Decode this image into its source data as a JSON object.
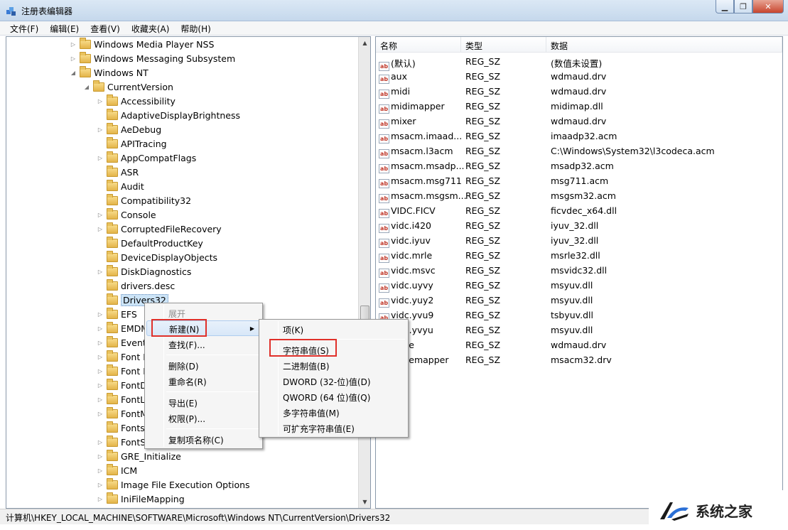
{
  "window": {
    "title": "注册表编辑器"
  },
  "menubar": [
    "文件(F)",
    "编辑(E)",
    "查看(V)",
    "收藏夹(A)",
    "帮助(H)"
  ],
  "tree": {
    "rows": [
      {
        "label": "Windows Media Player NSS",
        "indent": 1,
        "exp": "▷"
      },
      {
        "label": "Windows Messaging Subsystem",
        "indent": 1,
        "exp": "▷"
      },
      {
        "label": "Windows NT",
        "indent": 1,
        "exp": "◢"
      },
      {
        "label": "CurrentVersion",
        "indent": 2,
        "exp": "◢"
      },
      {
        "label": "Accessibility",
        "indent": 3,
        "exp": "▷"
      },
      {
        "label": "AdaptiveDisplayBrightness",
        "indent": 3,
        "exp": ""
      },
      {
        "label": "AeDebug",
        "indent": 3,
        "exp": "▷"
      },
      {
        "label": "APITracing",
        "indent": 3,
        "exp": ""
      },
      {
        "label": "AppCompatFlags",
        "indent": 3,
        "exp": "▷"
      },
      {
        "label": "ASR",
        "indent": 3,
        "exp": ""
      },
      {
        "label": "Audit",
        "indent": 3,
        "exp": ""
      },
      {
        "label": "Compatibility32",
        "indent": 3,
        "exp": ""
      },
      {
        "label": "Console",
        "indent": 3,
        "exp": "▷"
      },
      {
        "label": "CorruptedFileRecovery",
        "indent": 3,
        "exp": "▷"
      },
      {
        "label": "DefaultProductKey",
        "indent": 3,
        "exp": ""
      },
      {
        "label": "DeviceDisplayObjects",
        "indent": 3,
        "exp": ""
      },
      {
        "label": "DiskDiagnostics",
        "indent": 3,
        "exp": "▷"
      },
      {
        "label": "drivers.desc",
        "indent": 3,
        "exp": ""
      },
      {
        "label": "Drivers32",
        "indent": 3,
        "exp": "",
        "selected": true
      },
      {
        "label": "EFS",
        "indent": 3,
        "exp": "▷"
      },
      {
        "label": "EMDM",
        "indent": 3,
        "exp": "▷"
      },
      {
        "label": "Event V",
        "indent": 3,
        "exp": "▷"
      },
      {
        "label": "Font D",
        "indent": 3,
        "exp": "▷"
      },
      {
        "label": "Font M",
        "indent": 3,
        "exp": "▷"
      },
      {
        "label": "FontDi",
        "indent": 3,
        "exp": "▷"
      },
      {
        "label": "FontLin",
        "indent": 3,
        "exp": "▷"
      },
      {
        "label": "FontMa",
        "indent": 3,
        "exp": "▷"
      },
      {
        "label": "Fonts",
        "indent": 3,
        "exp": ""
      },
      {
        "label": "FontSu",
        "indent": 3,
        "exp": "▷"
      },
      {
        "label": "GRE_Initialize",
        "indent": 3,
        "exp": "▷"
      },
      {
        "label": "ICM",
        "indent": 3,
        "exp": "▷"
      },
      {
        "label": "Image File Execution Options",
        "indent": 3,
        "exp": "▷"
      },
      {
        "label": "IniFileMapping",
        "indent": 3,
        "exp": "▷"
      }
    ]
  },
  "values": {
    "headers": [
      "名称",
      "类型",
      "数据"
    ],
    "rows": [
      {
        "name": "(默认)",
        "type": "REG_SZ",
        "data": "(数值未设置)"
      },
      {
        "name": "aux",
        "type": "REG_SZ",
        "data": "wdmaud.drv"
      },
      {
        "name": "midi",
        "type": "REG_SZ",
        "data": "wdmaud.drv"
      },
      {
        "name": "midimapper",
        "type": "REG_SZ",
        "data": "midimap.dll"
      },
      {
        "name": "mixer",
        "type": "REG_SZ",
        "data": "wdmaud.drv"
      },
      {
        "name": "msacm.imaad...",
        "type": "REG_SZ",
        "data": "imaadp32.acm"
      },
      {
        "name": "msacm.l3acm",
        "type": "REG_SZ",
        "data": "C:\\Windows\\System32\\l3codeca.acm"
      },
      {
        "name": "msacm.msadp...",
        "type": "REG_SZ",
        "data": "msadp32.acm"
      },
      {
        "name": "msacm.msg711",
        "type": "REG_SZ",
        "data": "msg711.acm"
      },
      {
        "name": "msacm.msgsm...",
        "type": "REG_SZ",
        "data": "msgsm32.acm"
      },
      {
        "name": "VIDC.FICV",
        "type": "REG_SZ",
        "data": "ficvdec_x64.dll"
      },
      {
        "name": "vidc.i420",
        "type": "REG_SZ",
        "data": "iyuv_32.dll"
      },
      {
        "name": "vidc.iyuv",
        "type": "REG_SZ",
        "data": "iyuv_32.dll"
      },
      {
        "name": "vidc.mrle",
        "type": "REG_SZ",
        "data": "msrle32.dll"
      },
      {
        "name": "vidc.msvc",
        "type": "REG_SZ",
        "data": "msvidc32.dll"
      },
      {
        "name": "vidc.uyvy",
        "type": "REG_SZ",
        "data": "msyuv.dll"
      },
      {
        "name": "vidc.yuy2",
        "type": "REG_SZ",
        "data": "msyuv.dll"
      },
      {
        "name": "vidc.yvu9",
        "type": "REG_SZ",
        "data": "tsbyuv.dll"
      },
      {
        "name": "vidc.yvyu",
        "type": "REG_SZ",
        "data": "msyuv.dll"
      },
      {
        "name": "wave",
        "type": "REG_SZ",
        "data": "wdmaud.drv"
      },
      {
        "name": "wavemapper",
        "type": "REG_SZ",
        "data": "msacm32.drv"
      }
    ]
  },
  "context_menu": {
    "expand": "展开",
    "new": "新建(N)",
    "find": "查找(F)...",
    "delete": "删除(D)",
    "rename": "重命名(R)",
    "export": "导出(E)",
    "permissions": "权限(P)...",
    "copy_key_name": "复制项名称(C)"
  },
  "submenu": {
    "key": "项(K)",
    "string": "字符串值(S)",
    "binary": "二进制值(B)",
    "dword": "DWORD (32-位)值(D)",
    "qword": "QWORD (64 位)值(Q)",
    "multi_string": "多字符串值(M)",
    "expandable_string": "可扩充字符串值(E)"
  },
  "statusbar": {
    "path": "计算机\\HKEY_LOCAL_MACHINE\\SOFTWARE\\Microsoft\\Windows NT\\CurrentVersion\\Drivers32"
  },
  "watermark": {
    "text": "系统之家"
  },
  "colors": {
    "highlight_box": "#e0302a",
    "selection": "#cce4f7"
  }
}
